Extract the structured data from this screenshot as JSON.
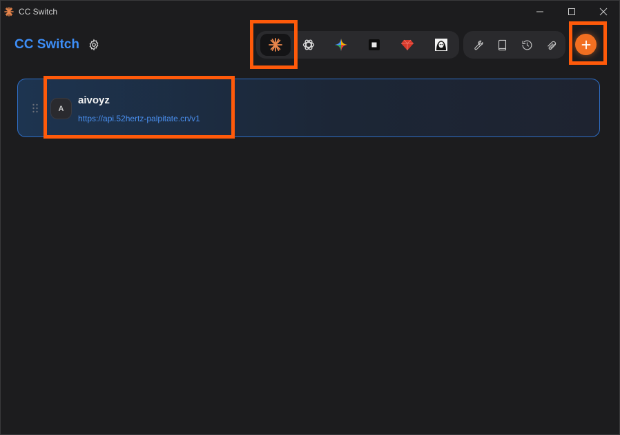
{
  "window": {
    "title": "CC Switch",
    "controls": [
      "minimize-icon",
      "maximize-icon",
      "close-icon"
    ]
  },
  "header": {
    "brand": "CC Switch",
    "settings_icon": "gear-icon"
  },
  "apps": [
    {
      "name": "claude",
      "icon": "claude-starburst-icon",
      "active": true
    },
    {
      "name": "openai",
      "icon": "openai-knot-icon",
      "active": false
    },
    {
      "name": "gemini",
      "icon": "gemini-sparkle-icon",
      "active": false
    },
    {
      "name": "square",
      "icon": "square-terminal-icon",
      "active": false
    },
    {
      "name": "ruby",
      "icon": "red-gem-icon",
      "active": false
    },
    {
      "name": "portrait",
      "icon": "portrait-icon",
      "active": false
    }
  ],
  "tools": [
    {
      "name": "wrench",
      "icon": "wrench-icon"
    },
    {
      "name": "book",
      "icon": "book-icon"
    },
    {
      "name": "history",
      "icon": "history-icon"
    },
    {
      "name": "paperclip",
      "icon": "paperclip-icon"
    }
  ],
  "add_button": {
    "icon": "plus-icon"
  },
  "providers": [
    {
      "avatar_letter": "A",
      "name": "aivoyz",
      "url": "https://api.52hertz-palpitate.cn/v1"
    }
  ],
  "colors": {
    "accent_blue": "#3d8ef8",
    "highlight_orange": "#ff5a0a",
    "add_orange": "#f26f21",
    "background": "#1c1c1e"
  }
}
